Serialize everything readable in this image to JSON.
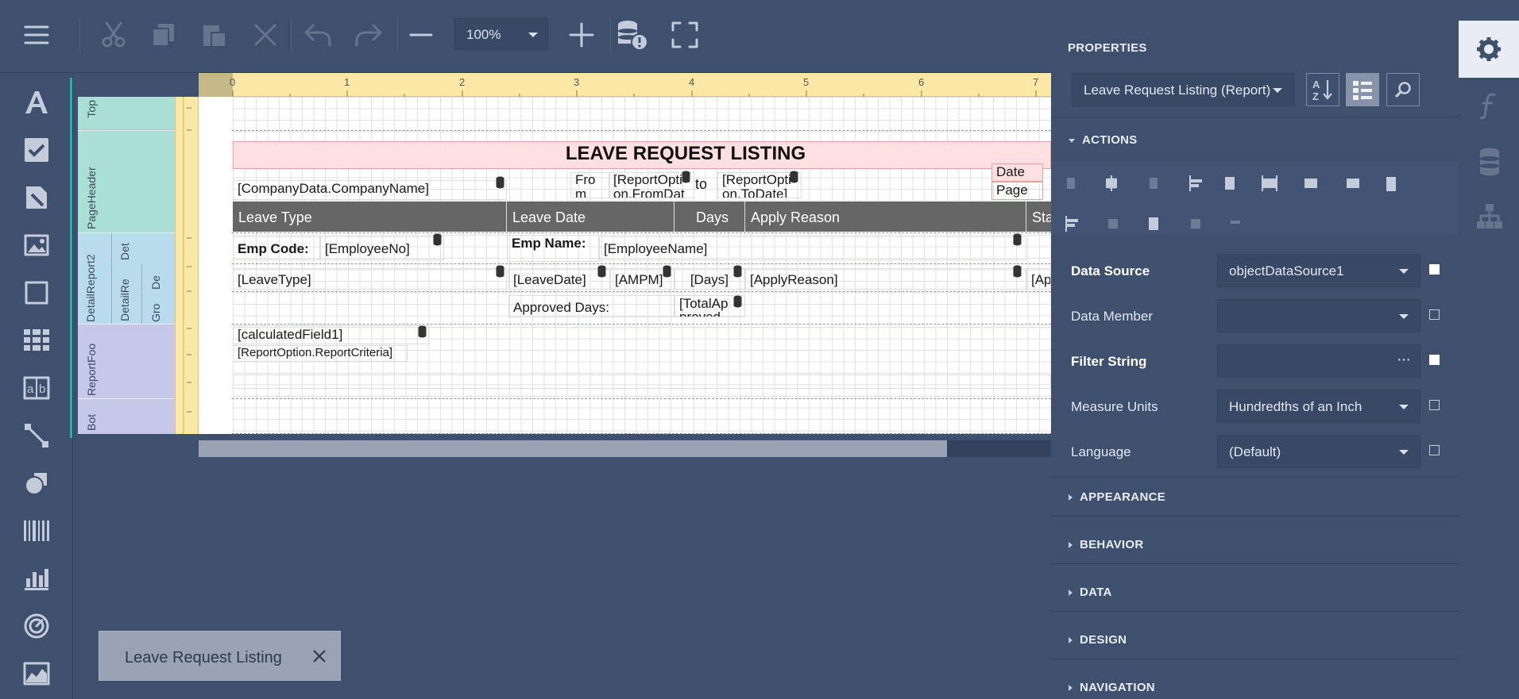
{
  "toolbar": {
    "zoom_value": "100%"
  },
  "ruler": {
    "marks": [
      "0",
      "1",
      "2",
      "3",
      "4",
      "5",
      "6",
      "7"
    ]
  },
  "bands": {
    "top": "Top",
    "page_header": "PageHeader",
    "detail_report2": "DetailReport2",
    "detail_a": "Det",
    "detail_report_inner": "DetailRe",
    "detail_b": "De",
    "group": "Gro",
    "report_footer": "ReportFoo",
    "bottom": "Bot"
  },
  "report": {
    "title": "LEAVE REQUEST LISTING",
    "company_name": "[CompanyData.CompanyName]",
    "from_label": "Fro m",
    "from_date": "[ReportOpti on.FromDat",
    "to_label": "to",
    "to_date": "[ReportOpti on.ToDate]",
    "date_label": "Date",
    "page_label": "Page",
    "columns": [
      "Leave Type",
      "Leave Date",
      "Days",
      "Apply Reason",
      "Sta"
    ],
    "emp_code_label": "Emp Code:",
    "emp_no": "[EmployeeNo]",
    "emp_name_label": "Emp Name:",
    "emp_name": "[EmployeeName]",
    "leave_type": "[LeaveType]",
    "leave_date": "[LeaveDate]",
    "ampm": "[AMPM]",
    "days": "[Days]",
    "apply_reason": "[ApplyReason]",
    "status": "[Ap",
    "approved_days_label": "Approved Days:",
    "total_approved": "[TotalAp proved",
    "calculated_field": "[calculatedField1]",
    "report_criteria": "[ReportOption.ReportCriteria]"
  },
  "tab": {
    "label": "Leave Request Listing"
  },
  "properties": {
    "title": "PROPERTIES",
    "selected_object": "Leave Request Listing (Report)",
    "actions_section": "ACTIONS",
    "fields": [
      {
        "label": "Data Source",
        "value": "objectDataSource1",
        "bold": true,
        "checked": true,
        "kind": "dropdown"
      },
      {
        "label": "Data Member",
        "value": "",
        "bold": false,
        "checked": false,
        "kind": "dropdown"
      },
      {
        "label": "Filter String",
        "value": "",
        "bold": true,
        "checked": true,
        "kind": "ellipsis"
      },
      {
        "label": "Measure Units",
        "value": "Hundredths of an Inch",
        "bold": false,
        "checked": false,
        "kind": "dropdown"
      },
      {
        "label": "Language",
        "value": "(Default)",
        "bold": false,
        "checked": false,
        "kind": "dropdown"
      }
    ],
    "sections": [
      "APPEARANCE",
      "BEHAVIOR",
      "DATA",
      "DESIGN",
      "NAVIGATION"
    ],
    "ellipsis": "···"
  },
  "colors": {
    "background": "#3f4f6e",
    "title_band": "#ffe0e0",
    "table_header": "#666666",
    "ruler": "#fce8a6",
    "band_top": "#a9dfd5",
    "band_detail": "#b8dcec",
    "band_footer": "#c5c8e8",
    "accent": "#1fb8a3"
  }
}
